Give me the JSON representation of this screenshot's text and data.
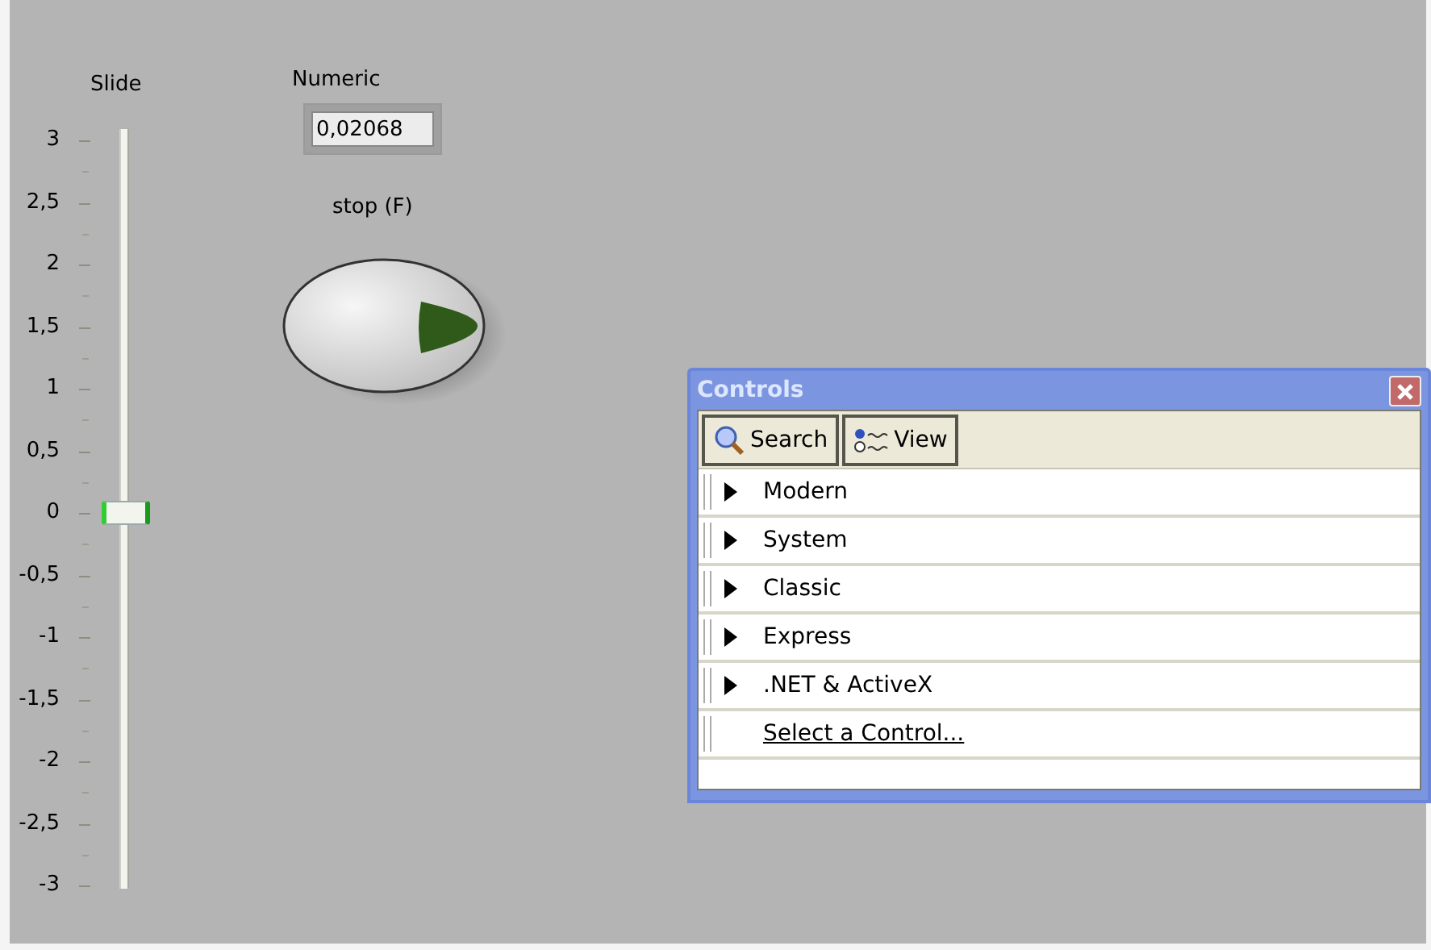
{
  "slide": {
    "label": "Slide",
    "level": 0.5,
    "ticks": [
      "3",
      "2,5",
      "2",
      "1,5",
      "1",
      "0,5",
      "0",
      "-0,5",
      "-1",
      "-1,5",
      "-2",
      "-2,5",
      "-3"
    ]
  },
  "numeric": {
    "label": "Numeric",
    "value": "0,02068"
  },
  "stop_button": {
    "label": "stop (F)"
  },
  "palette": {
    "title": "Controls",
    "buttons": [
      {
        "label": "Search",
        "kind": "search"
      },
      {
        "label": "View",
        "kind": "view"
      }
    ],
    "items": [
      {
        "label": "Modern",
        "kind": "category"
      },
      {
        "label": "System",
        "kind": "category"
      },
      {
        "label": "Classic",
        "kind": "category"
      },
      {
        "label": "Express",
        "kind": "category"
      },
      {
        "label": ".NET & ActiveX",
        "kind": "category"
      },
      {
        "label": "Select a Control...",
        "kind": "link"
      }
    ]
  }
}
